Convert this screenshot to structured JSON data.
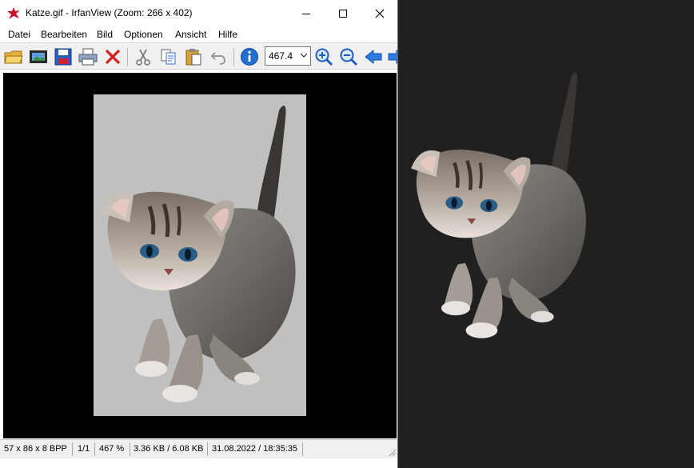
{
  "window": {
    "title": "Katze.gif - IrfanView (Zoom: 266 x 402)",
    "controls": {
      "minimize": "minimize-icon",
      "maximize": "maximize-icon",
      "close": "close-icon"
    }
  },
  "menu": {
    "items": [
      {
        "label": "Datei"
      },
      {
        "label": "Bearbeiten"
      },
      {
        "label": "Bild"
      },
      {
        "label": "Optionen"
      },
      {
        "label": "Ansicht"
      },
      {
        "label": "Hilfe"
      }
    ]
  },
  "toolbar": {
    "icons": [
      "open-folder-icon",
      "slideshow-icon",
      "save-icon",
      "print-icon",
      "delete-icon",
      "cut-icon",
      "copy-icon",
      "paste-icon",
      "undo-icon",
      "info-icon",
      "zoom-in-icon",
      "zoom-out-icon",
      "previous-icon",
      "next-icon"
    ],
    "zoom_value": "467.4"
  },
  "statusbar": {
    "dimensions": "57 x 86 x 8 BPP",
    "page": "1/1",
    "zoom": "467 %",
    "filesize": "3.36 KB / 6.08 KB",
    "datetime": "31.08.2022 / 18:35:35"
  },
  "colors": {
    "desktop": "#202020",
    "viewer_bg": "#000000",
    "image_bg": "#c0c0c0",
    "close_red": "#e81123",
    "blue_icon": "#1f6fd1"
  }
}
